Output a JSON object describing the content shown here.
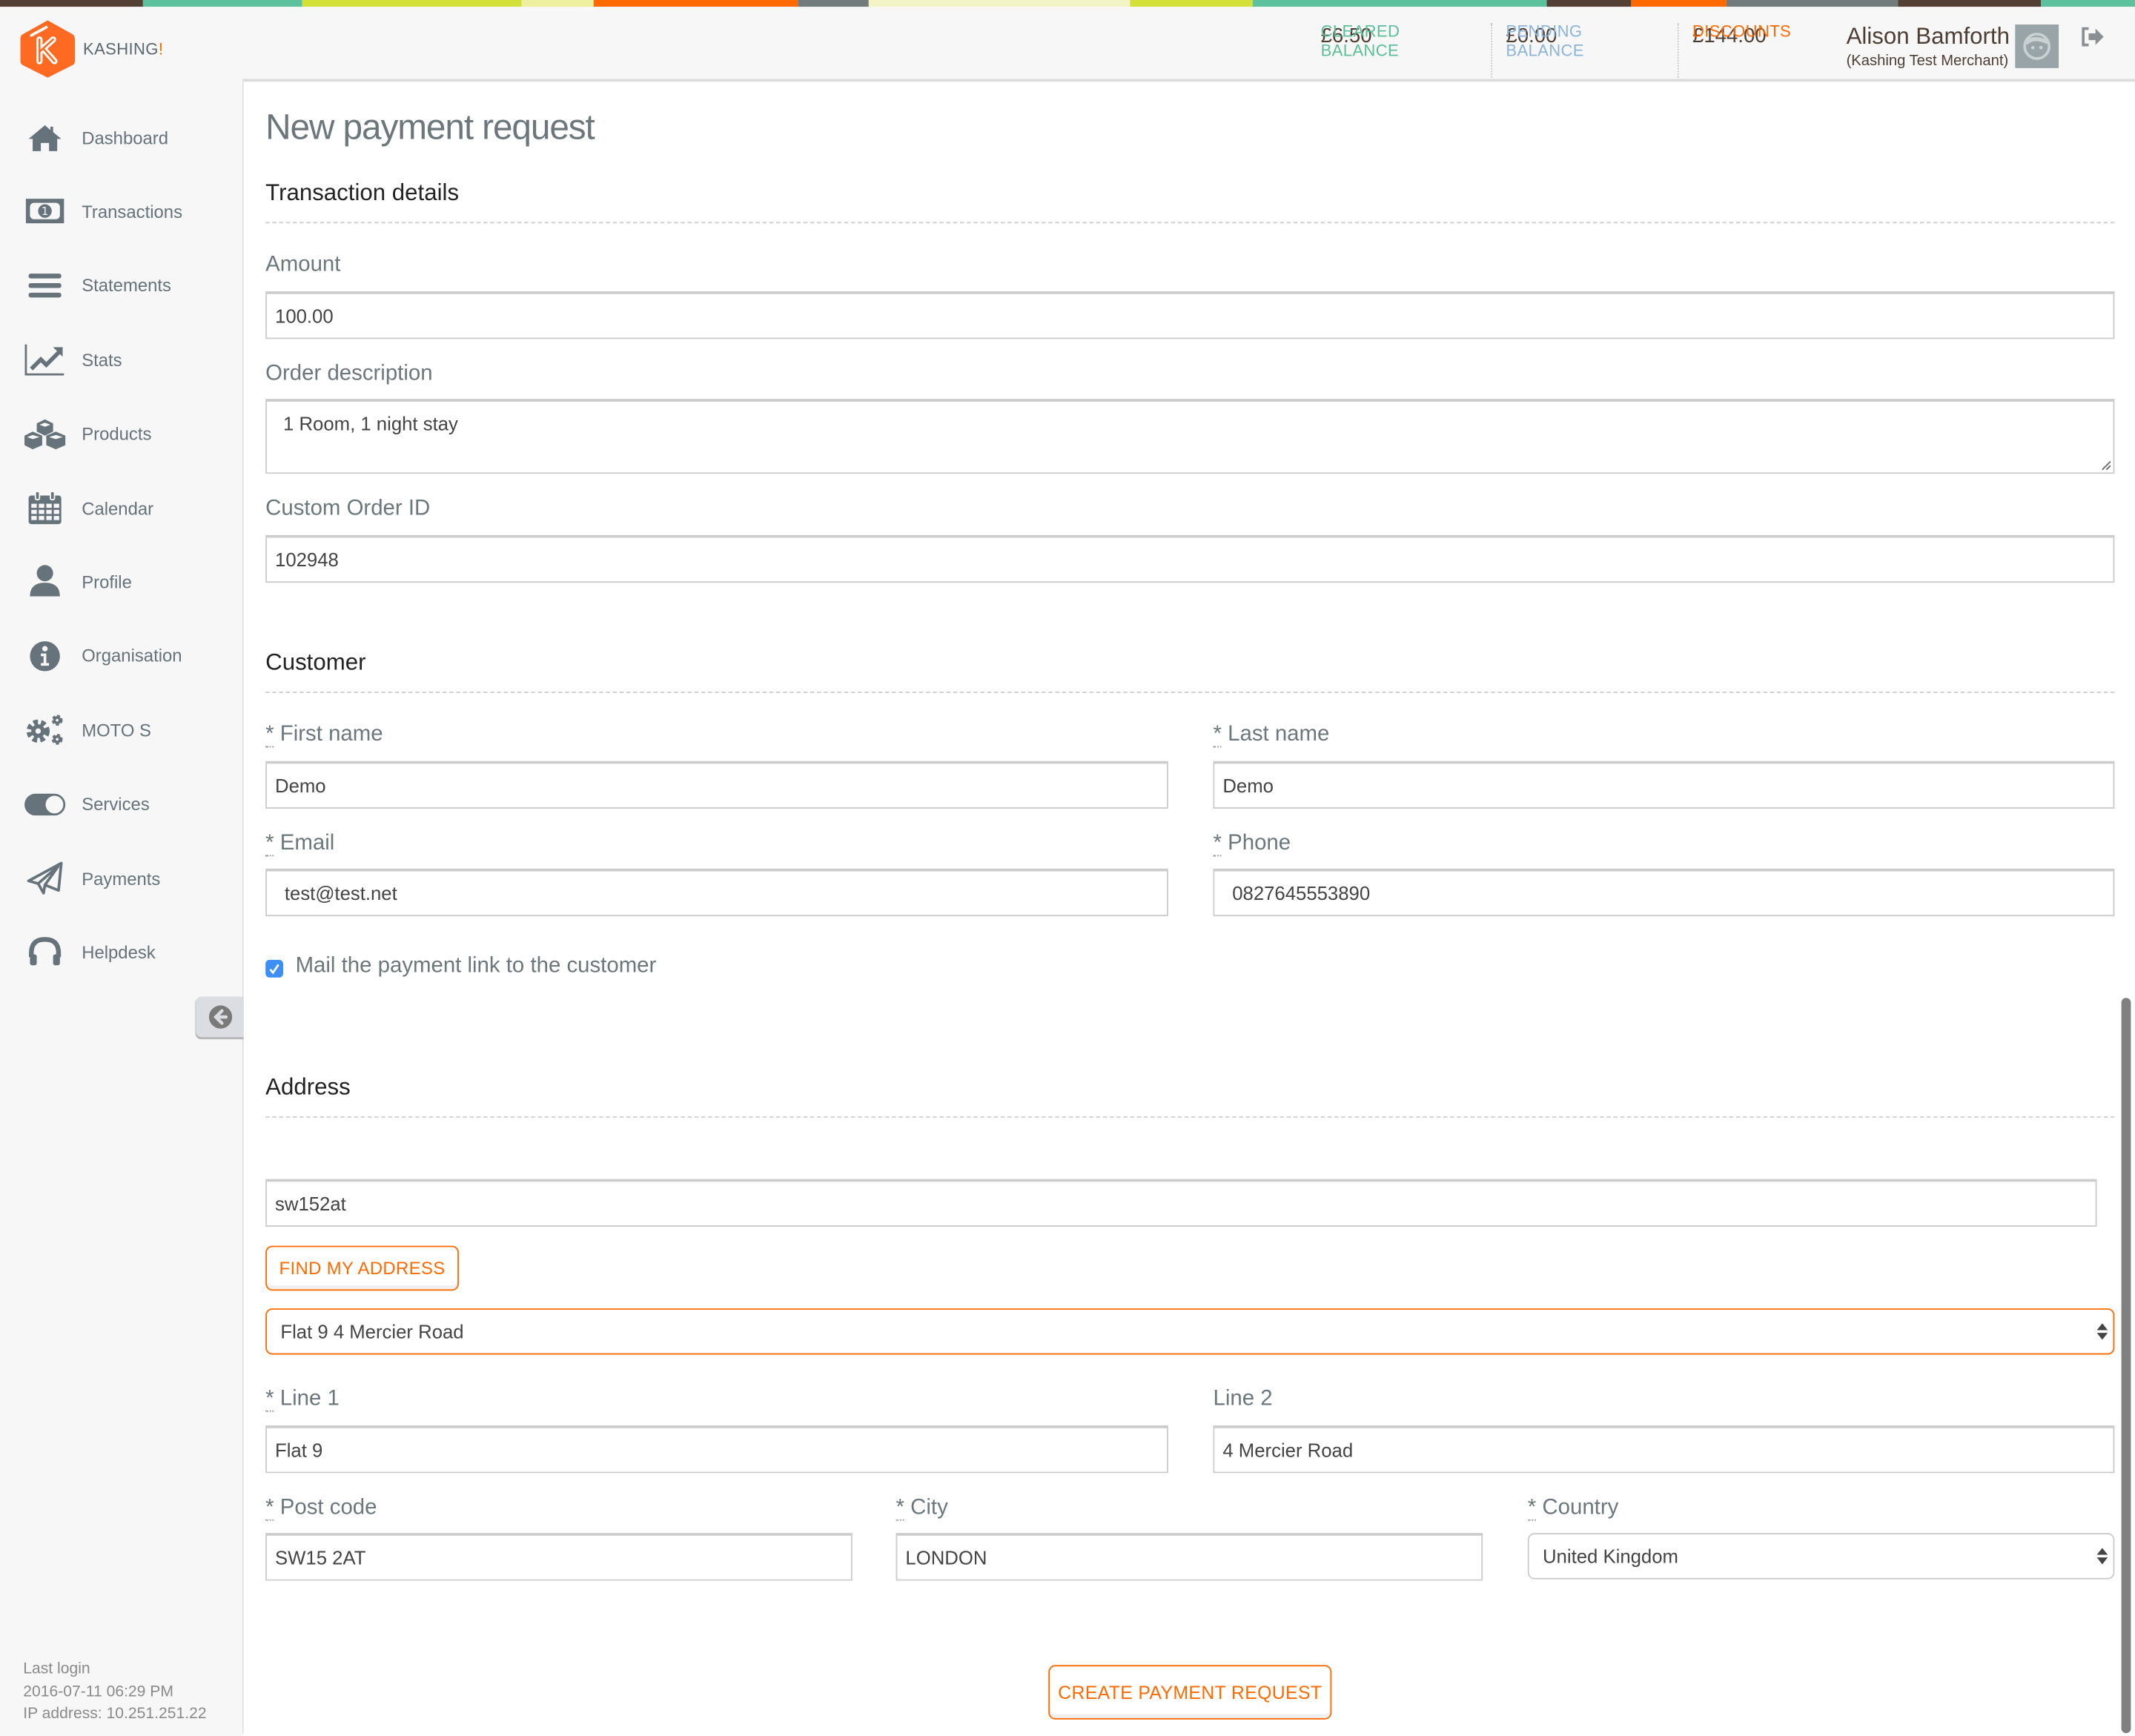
{
  "colorbar": [
    "#533f33",
    "#5cc29e",
    "#d3e038",
    "#eef09f",
    "#ff6a00",
    "#727b7b",
    "#f3f4c6",
    "#d3e038",
    "#5cc29e",
    "#533f33",
    "#ff6a00",
    "#727b7b",
    "#533f33",
    "#5cc29e"
  ],
  "brand": {
    "name": "KASHING",
    "bang": "!",
    "accent": "#ff6a00"
  },
  "header": {
    "cleared": {
      "label": "CLEARED BALANCE",
      "value": "£6.50",
      "color": "#5cbf9b"
    },
    "pending": {
      "label": "PENDING BALANCE",
      "value": "£0.00",
      "color": "#8ab4d9"
    },
    "discounts": {
      "label": "DISCOUNTS",
      "value": "£144.00",
      "color": "#ff6a00"
    },
    "user_name": "Alison Bamforth",
    "user_org": "(Kashing Test Merchant)"
  },
  "sidebar": {
    "items": [
      {
        "label": "Dashboard",
        "icon": "home-icon"
      },
      {
        "label": "Transactions",
        "icon": "banknote-icon"
      },
      {
        "label": "Statements",
        "icon": "list-icon"
      },
      {
        "label": "Stats",
        "icon": "chart-icon"
      },
      {
        "label": "Products",
        "icon": "cubes-icon"
      },
      {
        "label": "Calendar",
        "icon": "calendar-icon"
      },
      {
        "label": "Profile",
        "icon": "user-icon"
      },
      {
        "label": "Organisation",
        "icon": "info-icon"
      },
      {
        "label": "MOTO S",
        "icon": "gears-icon"
      },
      {
        "label": "Services",
        "icon": "toggle-icon"
      },
      {
        "label": "Payments",
        "icon": "paper-plane-icon"
      },
      {
        "label": "Helpdesk",
        "icon": "headphones-icon"
      }
    ],
    "last_login_label": "Last login",
    "last_login_time": "2016-07-11 06:29 PM",
    "ip_address": "IP address: 10.251.251.22"
  },
  "form": {
    "title": "New payment request",
    "transaction": {
      "section": "Transaction details",
      "amount_label": "Amount",
      "amount": "100.00",
      "description_label": "Order description",
      "description": "1 Room, 1 night stay",
      "order_id_label": "Custom Order ID",
      "order_id": "102948"
    },
    "customer": {
      "section": "Customer",
      "first_name_label": "First name",
      "first_name": "Demo",
      "last_name_label": "Last name",
      "last_name": "Demo",
      "email_label": "Email",
      "email": "test@test.net",
      "phone_label": "Phone",
      "phone": "0827645553890",
      "mail_link_label": "Mail the payment link to the customer",
      "mail_link_checked": true
    },
    "address": {
      "section": "Address",
      "postcode_search": "sw152at",
      "find_button": "FIND MY ADDRESS",
      "selected_address": "Flat 9 4 Mercier Road",
      "line1_label": "Line 1",
      "line1": "Flat 9",
      "line2_label": "Line 2",
      "line2": "4 Mercier Road",
      "postcode_label": "Post code",
      "postcode": "SW15 2AT",
      "city_label": "City",
      "city": "LONDON",
      "country_label": "Country",
      "country": "United Kingdom"
    },
    "required_marker": "*",
    "submit": "CREATE PAYMENT REQUEST"
  }
}
